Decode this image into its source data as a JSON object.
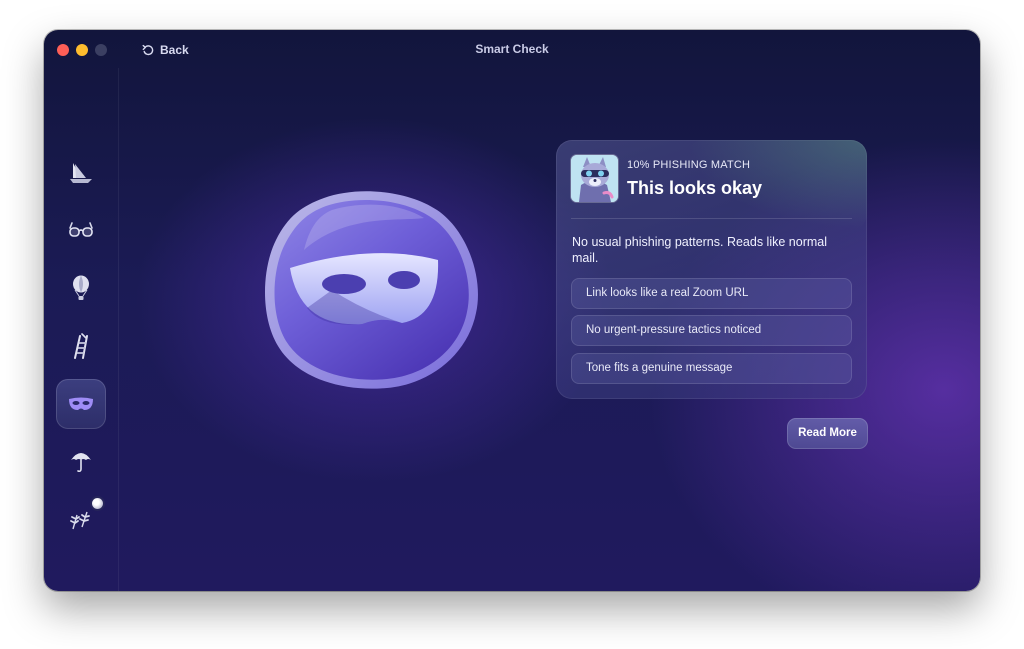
{
  "window": {
    "title": "Smart Check"
  },
  "toolbar": {
    "back_label": "Back",
    "back_icon": "undo-arrow-icon"
  },
  "sidebar": {
    "items": [
      {
        "icon": "sailboat-icon",
        "active": false
      },
      {
        "icon": "glasses-icon",
        "active": false
      },
      {
        "icon": "hot-air-balloon-icon",
        "active": false
      },
      {
        "icon": "ladder-icon",
        "active": false
      },
      {
        "icon": "mask-icon",
        "active": true
      },
      {
        "icon": "umbrella-icon",
        "active": false
      },
      {
        "icon": "leaves-icon",
        "active": false,
        "badge": true
      }
    ]
  },
  "result": {
    "match": "10% PHISHING MATCH",
    "verdict": "This looks okay",
    "summary": "No usual phishing patterns. Reads like normal mail.",
    "reasons": [
      "Link looks like a real Zoom URL",
      "No urgent-pressure tactics noticed",
      "Tone fits a genuine message"
    ],
    "read_more": "Read More"
  },
  "colors": {
    "accent": "#7b72e6",
    "traffic_red": "#fe5f57",
    "traffic_yellow": "#febc2e"
  }
}
